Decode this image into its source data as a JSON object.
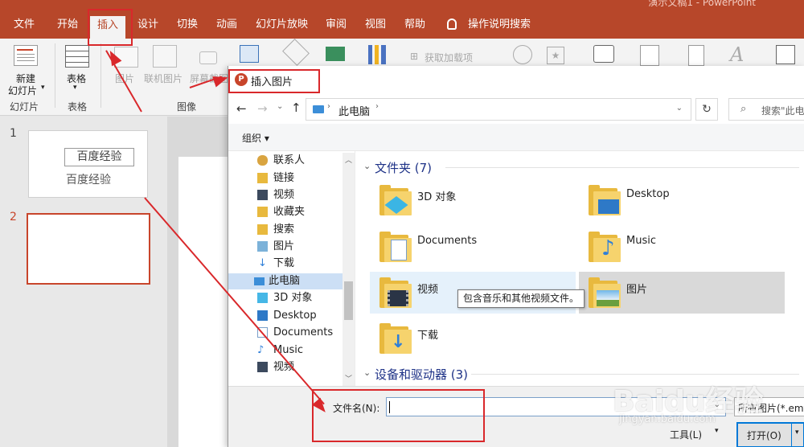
{
  "titlebar": {
    "text": "演示文稿1 - PowerPoint"
  },
  "tabs": [
    "文件",
    "开始",
    "插入",
    "设计",
    "切换",
    "动画",
    "幻灯片放映",
    "审阅",
    "视图",
    "帮助"
  ],
  "tabs_active": "插入",
  "tellme": "操作说明搜索",
  "ribbon": {
    "new_slide": "新建",
    "new_slide2": "幻灯片",
    "table": "表格",
    "picture": "图片",
    "online_picture": "联机图片",
    "screenshot": "屏幕截图",
    "addins": "获取加载项",
    "groups": {
      "slides": "幻灯片",
      "tables": "表格",
      "images": "图像"
    }
  },
  "slides": {
    "n1": "1",
    "n2": "2",
    "s1_box": "百度经验",
    "s1_text": "百度经验"
  },
  "dialog": {
    "title": "插入图片",
    "location": "此电脑",
    "search_placeholder": "搜索\"此电脑\"",
    "organize": "组织 ▾",
    "nav_items": [
      "联系人",
      "链接",
      "视频",
      "收藏夹",
      "搜索",
      "图片",
      "下载",
      "此电脑",
      "3D 对象",
      "Desktop",
      "Documents",
      "Music",
      "视频",
      "图片"
    ],
    "section_folders": "文件夹 (7)",
    "section_devices": "设备和驱动器 (3)",
    "folders": [
      "3D 对象",
      "Desktop",
      "Documents",
      "Music",
      "视频",
      "图片",
      "下载"
    ],
    "tooltip": "包含音乐和其他视频文件。",
    "filename_label": "文件名(N):",
    "filename_value": "",
    "filter": "所有图片(*.emf",
    "tools": "工具(L)",
    "open": "打开(O)"
  },
  "watermark": {
    "brand": "Baidu经验",
    "url": "jingyan.baidu.com"
  },
  "colors": {
    "accent": "#b7472a",
    "annotation": "#d9282b"
  }
}
